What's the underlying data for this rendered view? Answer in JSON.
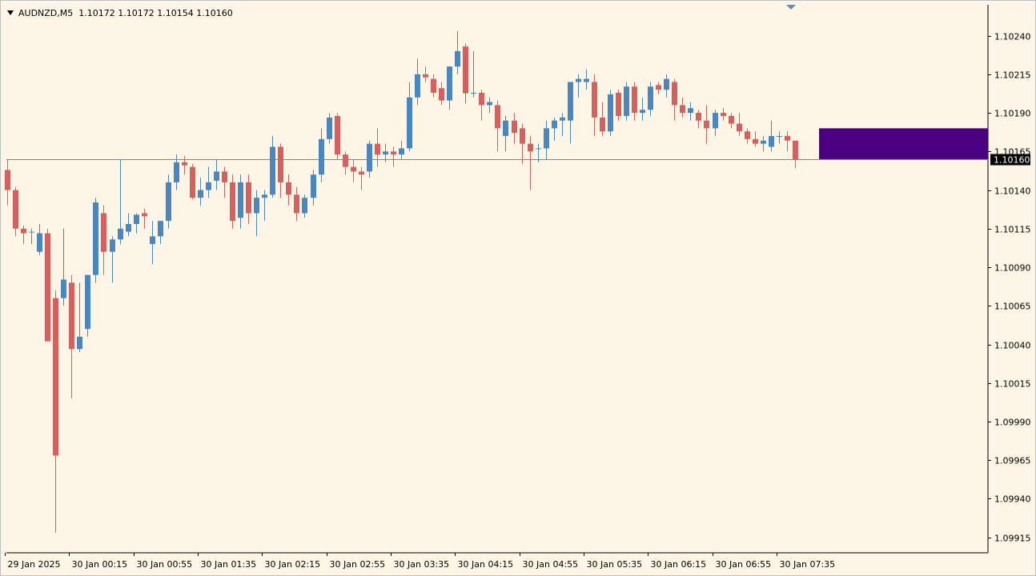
{
  "header": {
    "symbol": "AUDNZD,M5",
    "ohlc": "1.10172 1.10172 1.10154 1.10160"
  },
  "colors": {
    "background": "#fdf5e6",
    "bull": "#4a86c0",
    "bear": "#d46060",
    "current_candle_wick": "#00cc00",
    "bid_line": "#6a8ca8",
    "zone": "#4b0082",
    "price_tag": "#000000"
  },
  "chart_data": {
    "type": "candlestick",
    "ylim": [
      1.09905,
      1.1026
    ],
    "y_ticks": [
      "1.10240",
      "1.10215",
      "1.10190",
      "1.10165",
      "1.10140",
      "1.10115",
      "1.10090",
      "1.10065",
      "1.10040",
      "1.10015",
      "1.09990",
      "1.09965",
      "1.09940",
      "1.09915"
    ],
    "x_ticks": [
      "29 Jan 2025",
      "30 Jan 00:15",
      "30 Jan 00:55",
      "30 Jan 01:35",
      "30 Jan 02:15",
      "30 Jan 02:55",
      "30 Jan 03:35",
      "30 Jan 04:15",
      "30 Jan 04:55",
      "30 Jan 05:35",
      "30 Jan 06:15",
      "30 Jan 06:55",
      "30 Jan 07:35"
    ],
    "x_tick_index": [
      0,
      8,
      16,
      24,
      32,
      40,
      48,
      56,
      64,
      72,
      80,
      88,
      96
    ],
    "current_price": "1.10160",
    "current_value": 1.1016,
    "zone": {
      "from_index": 101,
      "to_index": 122,
      "y_low": 1.1016,
      "y_high": 1.1018
    },
    "candles": [
      {
        "o": 1.10153,
        "h": 1.1016,
        "l": 1.1013,
        "c": 1.1014
      },
      {
        "o": 1.1014,
        "h": 1.10142,
        "l": 1.1011,
        "c": 1.10115
      },
      {
        "o": 1.10115,
        "h": 1.10117,
        "l": 1.10105,
        "c": 1.10112
      },
      {
        "o": 1.10113,
        "h": 1.10115,
        "l": 1.10105,
        "c": 1.10113
      },
      {
        "o": 1.101,
        "h": 1.10118,
        "l": 1.10098,
        "c": 1.10112
      },
      {
        "o": 1.10112,
        "h": 1.10115,
        "l": 1.10042,
        "c": 1.10042
      },
      {
        "o": 1.1007,
        "h": 1.10075,
        "l": 1.09918,
        "c": 1.09968
      },
      {
        "o": 1.1007,
        "h": 1.10115,
        "l": 1.10065,
        "c": 1.10082
      },
      {
        "o": 1.1008,
        "h": 1.10085,
        "l": 1.10005,
        "c": 1.10037
      },
      {
        "o": 1.10037,
        "h": 1.1008,
        "l": 1.10035,
        "c": 1.10045
      },
      {
        "o": 1.1005,
        "h": 1.10085,
        "l": 1.10045,
        "c": 1.10085
      },
      {
        "o": 1.10085,
        "h": 1.10135,
        "l": 1.1008,
        "c": 1.10132
      },
      {
        "o": 1.10125,
        "h": 1.1013,
        "l": 1.10085,
        "c": 1.101
      },
      {
        "o": 1.101,
        "h": 1.1011,
        "l": 1.1008,
        "c": 1.10108
      },
      {
        "o": 1.10108,
        "h": 1.1016,
        "l": 1.10105,
        "c": 1.10115
      },
      {
        "o": 1.10113,
        "h": 1.10125,
        "l": 1.1011,
        "c": 1.10118
      },
      {
        "o": 1.10118,
        "h": 1.10125,
        "l": 1.10112,
        "c": 1.10124
      },
      {
        "o": 1.10125,
        "h": 1.10128,
        "l": 1.10115,
        "c": 1.10123
      },
      {
        "o": 1.10105,
        "h": 1.1012,
        "l": 1.10092,
        "c": 1.1011
      },
      {
        "o": 1.1011,
        "h": 1.1012,
        "l": 1.10105,
        "c": 1.1012
      },
      {
        "o": 1.1012,
        "h": 1.1015,
        "l": 1.10115,
        "c": 1.10145
      },
      {
        "o": 1.10145,
        "h": 1.10163,
        "l": 1.1014,
        "c": 1.10158
      },
      {
        "o": 1.10158,
        "h": 1.10162,
        "l": 1.1015,
        "c": 1.10156
      },
      {
        "o": 1.10155,
        "h": 1.10157,
        "l": 1.10134,
        "c": 1.10135
      },
      {
        "o": 1.10135,
        "h": 1.10148,
        "l": 1.1013,
        "c": 1.1014
      },
      {
        "o": 1.1014,
        "h": 1.10155,
        "l": 1.10135,
        "c": 1.10145
      },
      {
        "o": 1.10146,
        "h": 1.1016,
        "l": 1.1014,
        "c": 1.10152
      },
      {
        "o": 1.10152,
        "h": 1.10155,
        "l": 1.10135,
        "c": 1.10145
      },
      {
        "o": 1.10145,
        "h": 1.1015,
        "l": 1.10115,
        "c": 1.1012
      },
      {
        "o": 1.10122,
        "h": 1.1015,
        "l": 1.10115,
        "c": 1.10145
      },
      {
        "o": 1.10145,
        "h": 1.1015,
        "l": 1.10118,
        "c": 1.10125
      },
      {
        "o": 1.10125,
        "h": 1.1014,
        "l": 1.1011,
        "c": 1.10135
      },
      {
        "o": 1.10135,
        "h": 1.1014,
        "l": 1.1012,
        "c": 1.10137
      },
      {
        "o": 1.10137,
        "h": 1.10175,
        "l": 1.10135,
        "c": 1.10168
      },
      {
        "o": 1.10168,
        "h": 1.1017,
        "l": 1.10135,
        "c": 1.10145
      },
      {
        "o": 1.10145,
        "h": 1.1015,
        "l": 1.1013,
        "c": 1.10137
      },
      {
        "o": 1.10137,
        "h": 1.10142,
        "l": 1.1012,
        "c": 1.10125
      },
      {
        "o": 1.10125,
        "h": 1.10137,
        "l": 1.10122,
        "c": 1.10135
      },
      {
        "o": 1.10135,
        "h": 1.10153,
        "l": 1.1013,
        "c": 1.1015
      },
      {
        "o": 1.1015,
        "h": 1.1018,
        "l": 1.10145,
        "c": 1.10173
      },
      {
        "o": 1.10173,
        "h": 1.1019,
        "l": 1.1017,
        "c": 1.10187
      },
      {
        "o": 1.10188,
        "h": 1.1019,
        "l": 1.1016,
        "c": 1.10163
      },
      {
        "o": 1.10163,
        "h": 1.10165,
        "l": 1.1015,
        "c": 1.10155
      },
      {
        "o": 1.10155,
        "h": 1.1016,
        "l": 1.10145,
        "c": 1.10152
      },
      {
        "o": 1.10152,
        "h": 1.10155,
        "l": 1.1014,
        "c": 1.1015
      },
      {
        "o": 1.10152,
        "h": 1.10172,
        "l": 1.10148,
        "c": 1.1017
      },
      {
        "o": 1.1017,
        "h": 1.1018,
        "l": 1.10155,
        "c": 1.10163
      },
      {
        "o": 1.10163,
        "h": 1.1017,
        "l": 1.10158,
        "c": 1.10165
      },
      {
        "o": 1.10165,
        "h": 1.10168,
        "l": 1.10155,
        "c": 1.10163
      },
      {
        "o": 1.10163,
        "h": 1.10172,
        "l": 1.1016,
        "c": 1.10167
      },
      {
        "o": 1.10167,
        "h": 1.1021,
        "l": 1.10165,
        "c": 1.102
      },
      {
        "o": 1.102,
        "h": 1.10225,
        "l": 1.10195,
        "c": 1.10215
      },
      {
        "o": 1.10215,
        "h": 1.1022,
        "l": 1.1021,
        "c": 1.10213
      },
      {
        "o": 1.10212,
        "h": 1.10215,
        "l": 1.102,
        "c": 1.10203
      },
      {
        "o": 1.10206,
        "h": 1.1021,
        "l": 1.10195,
        "c": 1.10198
      },
      {
        "o": 1.10198,
        "h": 1.1022,
        "l": 1.10192,
        "c": 1.1022
      },
      {
        "o": 1.1022,
        "h": 1.10243,
        "l": 1.10215,
        "c": 1.1023
      },
      {
        "o": 1.10233,
        "h": 1.10235,
        "l": 1.10196,
        "c": 1.10203
      },
      {
        "o": 1.10203,
        "h": 1.1023,
        "l": 1.102,
        "c": 1.10203
      },
      {
        "o": 1.10203,
        "h": 1.10205,
        "l": 1.10185,
        "c": 1.10195
      },
      {
        "o": 1.10195,
        "h": 1.102,
        "l": 1.1019,
        "c": 1.10197
      },
      {
        "o": 1.10195,
        "h": 1.10198,
        "l": 1.10165,
        "c": 1.1018
      },
      {
        "o": 1.10175,
        "h": 1.10188,
        "l": 1.10165,
        "c": 1.10185
      },
      {
        "o": 1.10185,
        "h": 1.1019,
        "l": 1.1017,
        "c": 1.10177
      },
      {
        "o": 1.1018,
        "h": 1.10183,
        "l": 1.10157,
        "c": 1.1017
      },
      {
        "o": 1.1017,
        "h": 1.10175,
        "l": 1.1014,
        "c": 1.10165
      },
      {
        "o": 1.10167,
        "h": 1.1017,
        "l": 1.10158,
        "c": 1.10167
      },
      {
        "o": 1.10167,
        "h": 1.10185,
        "l": 1.1016,
        "c": 1.1018
      },
      {
        "o": 1.1018,
        "h": 1.10187,
        "l": 1.10172,
        "c": 1.10185
      },
      {
        "o": 1.10185,
        "h": 1.1019,
        "l": 1.10175,
        "c": 1.10187
      },
      {
        "o": 1.10185,
        "h": 1.102,
        "l": 1.1017,
        "c": 1.1021
      },
      {
        "o": 1.1021,
        "h": 1.10215,
        "l": 1.102,
        "c": 1.10212
      },
      {
        "o": 1.1021,
        "h": 1.10218,
        "l": 1.10205,
        "c": 1.10212
      },
      {
        "o": 1.1021,
        "h": 1.10215,
        "l": 1.10175,
        "c": 1.10187
      },
      {
        "o": 1.10187,
        "h": 1.10197,
        "l": 1.10175,
        "c": 1.10178
      },
      {
        "o": 1.10178,
        "h": 1.10205,
        "l": 1.10175,
        "c": 1.10202
      },
      {
        "o": 1.10203,
        "h": 1.10205,
        "l": 1.10185,
        "c": 1.10188
      },
      {
        "o": 1.10188,
        "h": 1.1021,
        "l": 1.10185,
        "c": 1.10207
      },
      {
        "o": 1.10207,
        "h": 1.1021,
        "l": 1.10185,
        "c": 1.1019
      },
      {
        "o": 1.1019,
        "h": 1.102,
        "l": 1.10185,
        "c": 1.10192
      },
      {
        "o": 1.10192,
        "h": 1.1021,
        "l": 1.10188,
        "c": 1.10207
      },
      {
        "o": 1.10208,
        "h": 1.1021,
        "l": 1.10202,
        "c": 1.10205
      },
      {
        "o": 1.10205,
        "h": 1.10215,
        "l": 1.102,
        "c": 1.10212
      },
      {
        "o": 1.1021,
        "h": 1.10212,
        "l": 1.10185,
        "c": 1.10195
      },
      {
        "o": 1.10195,
        "h": 1.102,
        "l": 1.10187,
        "c": 1.1019
      },
      {
        "o": 1.1019,
        "h": 1.10197,
        "l": 1.10185,
        "c": 1.10193
      },
      {
        "o": 1.1019,
        "h": 1.10192,
        "l": 1.1018,
        "c": 1.10185
      },
      {
        "o": 1.10185,
        "h": 1.10195,
        "l": 1.1017,
        "c": 1.1018
      },
      {
        "o": 1.1018,
        "h": 1.10192,
        "l": 1.10175,
        "c": 1.1019
      },
      {
        "o": 1.1019,
        "h": 1.10193,
        "l": 1.10185,
        "c": 1.10188
      },
      {
        "o": 1.10188,
        "h": 1.1019,
        "l": 1.1018,
        "c": 1.10183
      },
      {
        "o": 1.10183,
        "h": 1.1019,
        "l": 1.10175,
        "c": 1.10178
      },
      {
        "o": 1.10178,
        "h": 1.1018,
        "l": 1.1017,
        "c": 1.10173
      },
      {
        "o": 1.10173,
        "h": 1.10178,
        "l": 1.10168,
        "c": 1.1017
      },
      {
        "o": 1.1017,
        "h": 1.10175,
        "l": 1.10165,
        "c": 1.10172
      },
      {
        "o": 1.10168,
        "h": 1.10185,
        "l": 1.10165,
        "c": 1.10175
      },
      {
        "o": 1.10175,
        "h": 1.10178,
        "l": 1.1017,
        "c": 1.10175
      },
      {
        "o": 1.10175,
        "h": 1.10178,
        "l": 1.10165,
        "c": 1.10172
      },
      {
        "o": 1.10172,
        "h": 1.10172,
        "l": 1.10154,
        "c": 1.1016
      }
    ]
  }
}
